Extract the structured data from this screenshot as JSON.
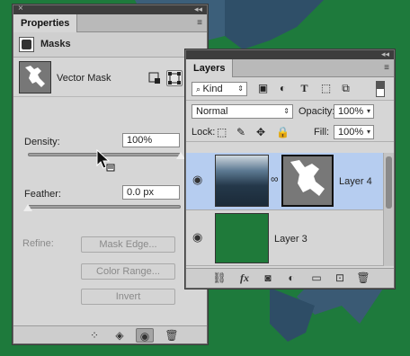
{
  "properties": {
    "tab": "Properties",
    "section": "Masks",
    "mask_type": "Vector Mask",
    "density_label": "Density:",
    "density_value": "100%",
    "density_level": 1.0,
    "feather_label": "Feather:",
    "feather_value": "0.0 px",
    "feather_level": 0.0,
    "refine_label": "Refine:",
    "mask_edge": "Mask Edge...",
    "color_range": "Color Range...",
    "invert": "Invert"
  },
  "layers": {
    "tab": "Layers",
    "filter": "Kind",
    "blend_mode": "Normal",
    "opacity_label": "Opacity:",
    "opacity_value": "100%",
    "lock_label": "Lock:",
    "fill_label": "Fill:",
    "fill_value": "100%",
    "items": [
      {
        "name": "Layer 4",
        "selected": true
      },
      {
        "name": "Layer 3",
        "selected": false
      }
    ]
  },
  "icons": {
    "close": "×",
    "collapse": "◂◂",
    "menu": "≡",
    "eye": "◉",
    "link": "∞"
  },
  "colors": {
    "background": "#1e7a3c",
    "layer3_fill": "#1f7a3a",
    "selection": "#b6cdf0"
  }
}
